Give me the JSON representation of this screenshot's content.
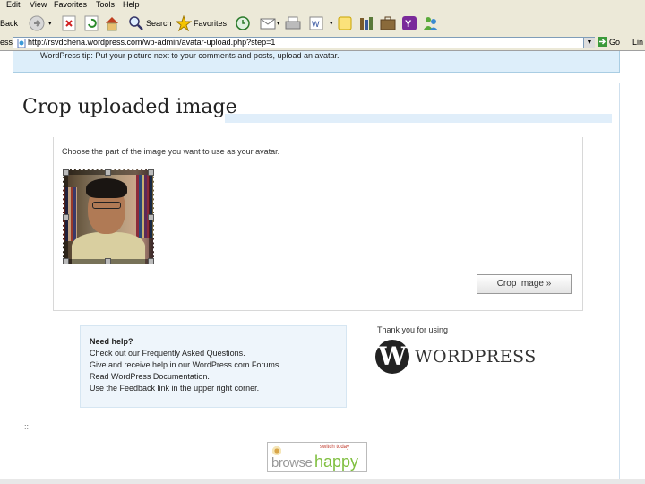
{
  "menu": [
    "Edit",
    "View",
    "Favorites",
    "Tools",
    "Help"
  ],
  "toolbar": {
    "back": "Back",
    "search": "Search",
    "favorites": "Favorites"
  },
  "address": {
    "label": "ess",
    "url": "http://rsvdchena.wordpress.com/wp-admin/avatar-upload.php?step=1",
    "go": "Go",
    "links": "Lin"
  },
  "notice": "WordPress tip: Put your picture next to your comments and posts, upload an avatar.",
  "page": {
    "heading": "Crop uploaded image",
    "instruction": "Choose the part of the image you want to use as your avatar.",
    "crop_button": "Crop Image »"
  },
  "help": {
    "title": "Need help?",
    "lines": [
      "Check out our Frequently Asked Questions.",
      "Give and receive help in our WordPress.com Forums.",
      "Read WordPress Documentation.",
      "Use the Feedback link in the upper right corner."
    ]
  },
  "thanks": "Thank you for using",
  "wordpress_logo": "WORDPRESS",
  "footer_mark": "::",
  "browsehappy": {
    "left": "browse",
    "right": "happy",
    "tag": "switch today"
  }
}
